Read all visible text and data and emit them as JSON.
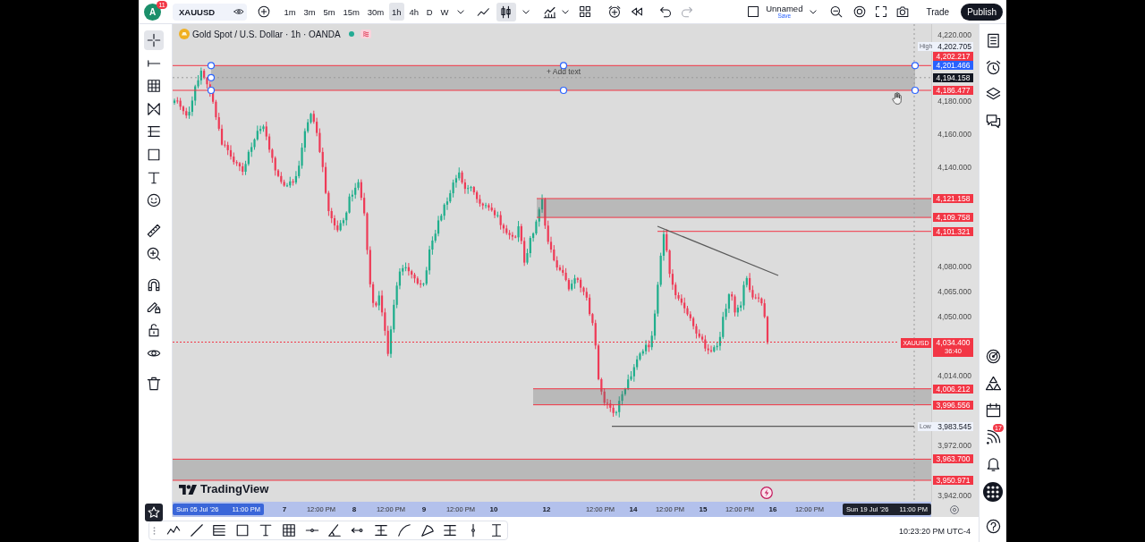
{
  "top_bar": {
    "avatar": {
      "initial": "A",
      "badge": "11"
    },
    "symbol": "XAUUSD",
    "intervals": [
      {
        "label": "1m",
        "selected": false
      },
      {
        "label": "3m",
        "selected": false
      },
      {
        "label": "5m",
        "selected": false
      },
      {
        "label": "15m",
        "selected": false
      },
      {
        "label": "30m",
        "selected": false
      },
      {
        "label": "1h",
        "selected": true
      },
      {
        "label": "4h",
        "selected": false
      },
      {
        "label": "D",
        "selected": false
      },
      {
        "label": "W",
        "selected": false
      }
    ],
    "chart_styles": [
      {
        "selected": false
      },
      {
        "selected": true
      }
    ],
    "layout": {
      "name": "Unnamed",
      "status": "Save"
    },
    "trade": "Trade",
    "publish": "Publish"
  },
  "left_toolbar": {
    "tools": [
      {
        "selected": true
      },
      {
        "selected": false
      },
      {
        "selected": false
      },
      {
        "selected": false
      },
      {
        "selected": false
      },
      {
        "selected": false
      },
      {
        "selected": false
      },
      {
        "selected": false
      },
      {
        "selected": false
      },
      {
        "selected": false
      },
      {
        "selected": false
      },
      {
        "selected": false
      },
      {
        "selected": false
      },
      {
        "selected": false
      },
      {
        "selected": false
      }
    ]
  },
  "legend": {
    "title": "Gold Spot / U.S. Dollar · 1h · OANDA",
    "market_open": true
  },
  "chart": {
    "rectangle_text": "+ Add text",
    "logo": "TradingView"
  },
  "price_axis": {
    "ticks": [
      "4,220.000",
      "4,180.000",
      "4,160.000",
      "4,140.000",
      "4,080.000",
      "4,065.000",
      "4,050.000",
      "4,014.000",
      "3,972.000",
      "3,942.000"
    ],
    "markers": [
      {
        "kind": "extreme",
        "label": "High",
        "price": "4,202.705"
      },
      {
        "kind": "level",
        "price": "4,202.217",
        "color": "#f23645"
      },
      {
        "kind": "level",
        "price": "4,201.466",
        "color": "#2962ff"
      },
      {
        "kind": "level",
        "price": "4,194.158",
        "color": "#131722"
      },
      {
        "kind": "level",
        "price": "4,186.477",
        "color": "#f23645"
      },
      {
        "kind": "level",
        "price": "4,121.158",
        "color": "#f23645"
      },
      {
        "kind": "level",
        "price": "4,109.758",
        "color": "#f23645"
      },
      {
        "kind": "level",
        "price": "4,101.321",
        "color": "#f23645"
      },
      {
        "kind": "last",
        "symbol": "XAUUSD",
        "price": "4,034.400",
        "countdown": "36:40",
        "color": "#f23645"
      },
      {
        "kind": "level",
        "price": "4,006.212",
        "color": "#f23645"
      },
      {
        "kind": "level",
        "price": "3,996.556",
        "color": "#f23645"
      },
      {
        "kind": "extreme",
        "label": "Low",
        "price": "3,983.545"
      },
      {
        "kind": "level",
        "price": "3,963.700",
        "color": "#f23645"
      },
      {
        "kind": "level",
        "price": "3,950.971",
        "color": "#f23645"
      }
    ]
  },
  "time_axis": {
    "range_start": {
      "date": "Sun 05 Jul '26",
      "time": "11:00 PM"
    },
    "labels": [
      {
        "text": "7",
        "kind": "day"
      },
      {
        "text": "12:00 PM",
        "kind": "time"
      },
      {
        "text": "8",
        "kind": "day"
      },
      {
        "text": "12:00 PM",
        "kind": "time"
      },
      {
        "text": "9",
        "kind": "day"
      },
      {
        "text": "12:00 PM",
        "kind": "time"
      },
      {
        "text": "10",
        "kind": "day"
      },
      {
        "text": "12",
        "kind": "day"
      },
      {
        "text": "12:00 PM",
        "kind": "time"
      },
      {
        "text": "14",
        "kind": "day"
      },
      {
        "text": "12:00 PM",
        "kind": "time"
      },
      {
        "text": "15",
        "kind": "day"
      },
      {
        "text": "12:00 PM",
        "kind": "time"
      },
      {
        "text": "16",
        "kind": "day"
      },
      {
        "text": "12:00 PM",
        "kind": "time"
      }
    ],
    "range_end": {
      "date": "Sun 19 Jul '26",
      "time": "11:00 PM"
    }
  },
  "bottom_bar": {
    "clock": "10:23:20 PM UTC-4"
  },
  "right_sidebar": {
    "alerts_badge": "17"
  }
}
